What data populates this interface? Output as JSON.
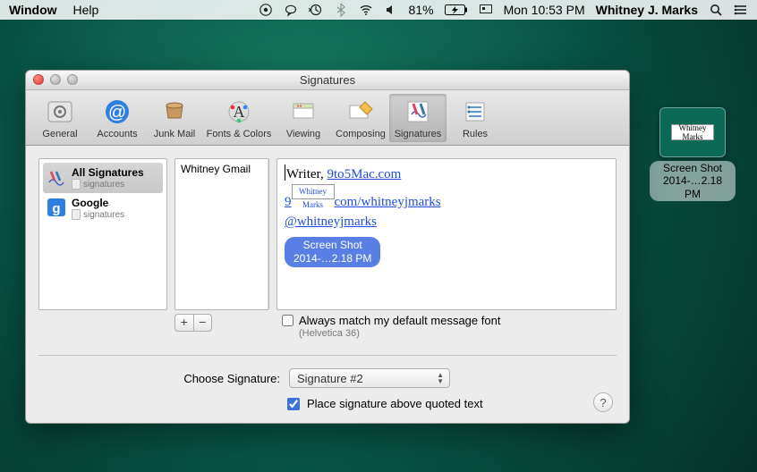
{
  "menubar": {
    "items": [
      "Window",
      "Help"
    ],
    "battery": "81%",
    "clock": "Mon 10:53 PM",
    "user": "Whitney J. Marks"
  },
  "desktop": {
    "thumb_text": "Whitney Marks",
    "label_line1": "Screen Shot",
    "label_line2": "2014-…2.18 PM"
  },
  "window": {
    "title": "Signatures",
    "toolbar": [
      {
        "id": "general",
        "label": "General"
      },
      {
        "id": "accounts",
        "label": "Accounts"
      },
      {
        "id": "junkmail",
        "label": "Junk Mail"
      },
      {
        "id": "fontscolors",
        "label": "Fonts & Colors"
      },
      {
        "id": "viewing",
        "label": "Viewing"
      },
      {
        "id": "composing",
        "label": "Composing"
      },
      {
        "id": "signatures",
        "label": "Signatures"
      },
      {
        "id": "rules",
        "label": "Rules"
      }
    ],
    "selected_toolbar": "signatures"
  },
  "accounts": [
    {
      "title": "All Signatures",
      "sub": "signatures",
      "icon": "pen"
    },
    {
      "title": "Google",
      "sub": "signatures",
      "icon": "google"
    }
  ],
  "siglist": {
    "items": [
      "Whitney Gmail"
    ]
  },
  "editor": {
    "prefix": "Writer, ",
    "link1": "9to5Mac.com",
    "line2_pre": "9",
    "line2_img_text": "Whitney Marks",
    "line2_post": "com/whitneyjmarks",
    "line3": "@whitneyjmarks",
    "chip_l1": "Screen Shot",
    "chip_l2": "2014-…2.18 PM"
  },
  "opts": {
    "match_font_label": "Always match my default message font",
    "match_font_sub": "(Helvetica 36)"
  },
  "choose": {
    "label": "Choose Signature:",
    "value": "Signature #2"
  },
  "place": {
    "label": "Place signature above quoted text",
    "checked": true
  }
}
